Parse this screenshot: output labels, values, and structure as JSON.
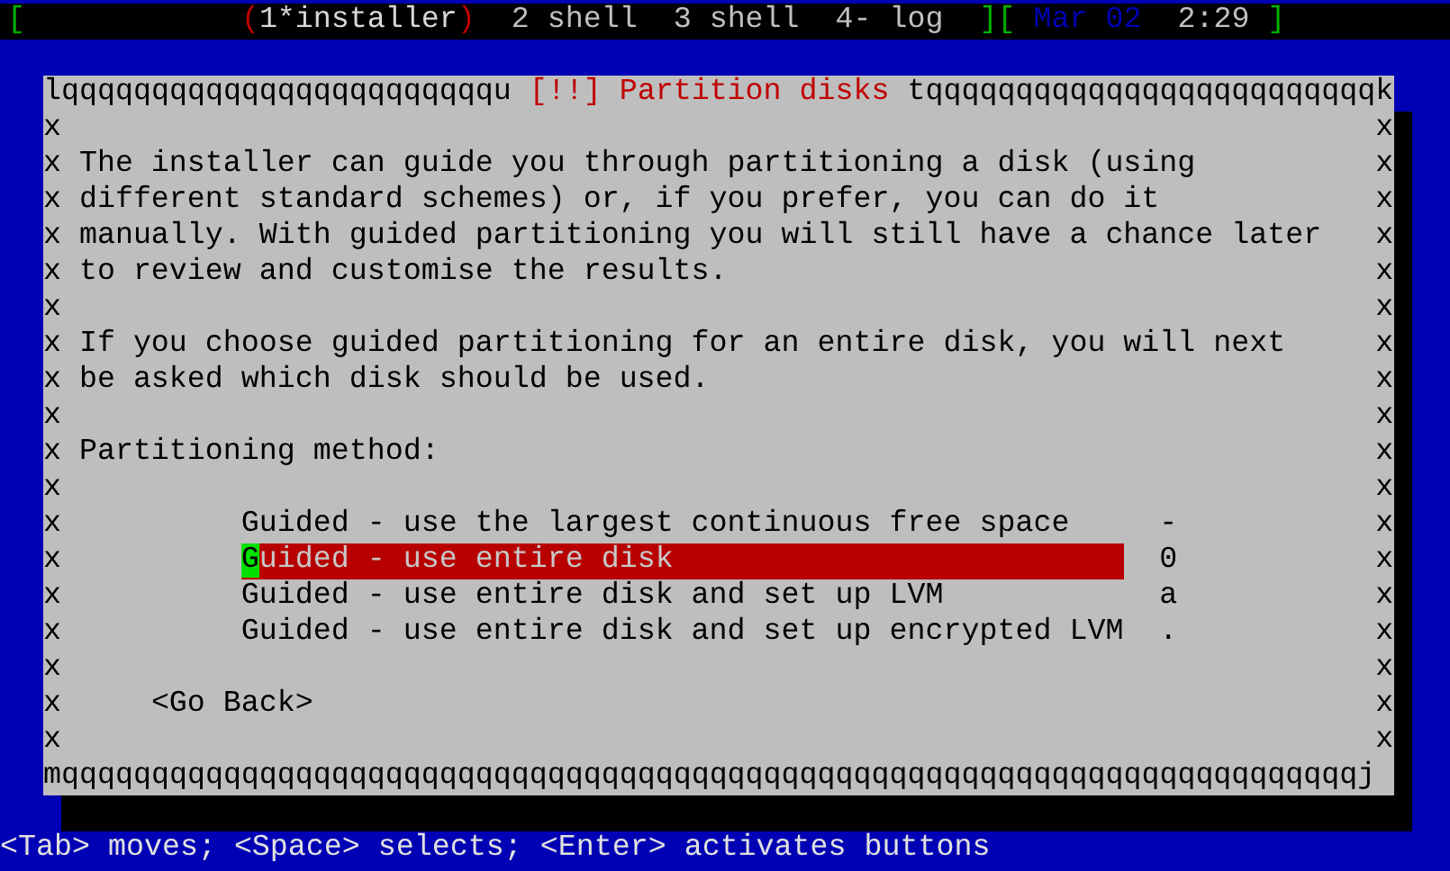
{
  "status_bar": {
    "left_bracket": "[",
    "windows": [
      {
        "left_mark": "(",
        "label": "1*installer",
        "right_mark": ")",
        "selected": true
      },
      {
        "label": "2 shell",
        "selected": false
      },
      {
        "label": "3 shell",
        "selected": false
      },
      {
        "label": "4- log",
        "selected": false
      }
    ],
    "middle_brackets": "][",
    "date": "Mar 02",
    "time": "2:29",
    "right_bracket": "]"
  },
  "dialog": {
    "top_left": "lqqqqqqqqqqqqqqqqqqqqqqqqu",
    "title": "[!!] Partition disks",
    "top_right": "tqqqqqqqqqqqqqqqqqqqqqqqqqk",
    "left_edge": "xxxxxxxxxxxxxxxxxx",
    "right_edge": "xxxxxxxxxxxxxxxxxx",
    "paragraphs": [
      "The installer can guide you through partitioning a disk (using different standard schemes) or, if you prefer, you can do it manually. With guided partitioning you will still have a chance later to review and customise the results.",
      "If you choose guided partitioning for an entire disk, you will next be asked which disk should be used."
    ],
    "method_label": "Partitioning method:",
    "options": [
      {
        "label": "Guided - use the largest continuous free space",
        "marker": "-",
        "selected": false
      },
      {
        "label": "Guided - use entire disk",
        "marker": "0",
        "selected": true
      },
      {
        "label": "Guided - use entire disk and set up LVM",
        "marker": "a",
        "selected": false
      },
      {
        "label": "Guided - use entire disk and set up encrypted LVM",
        "marker": ".",
        "selected": false
      }
    ],
    "back_button": "<Go Back>",
    "bottom_border": "mqqqqqqqqqqqqqqqqqqqqqqqqqqqqqqqqqqqqqqqqqqqqqqqqqqqqqqqqqqqqqqqqqqqqqqqqj"
  },
  "help_line": "<Tab> moves; <Space> selects; <Enter> activates buttons"
}
